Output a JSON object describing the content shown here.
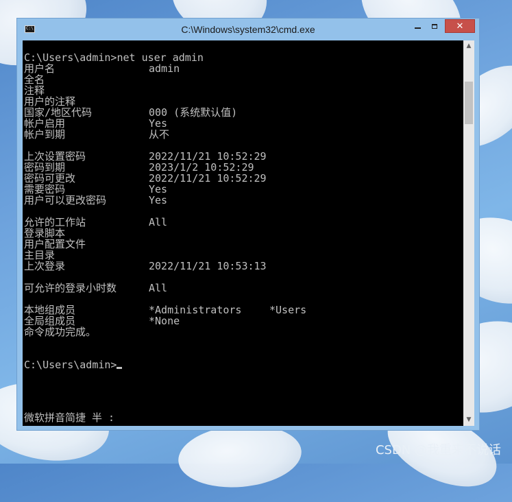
{
  "window": {
    "title": "C:\\Windows\\system32\\cmd.exe",
    "icon_text": "C:\\."
  },
  "console": {
    "lines": [
      {
        "c1": "C:\\Users\\admin>net user admin",
        "c2": "",
        "c3": ""
      },
      {
        "c1": "用户名",
        "c2": "admin",
        "c3": ""
      },
      {
        "c1": "全名",
        "c2": "",
        "c3": ""
      },
      {
        "c1": "注释",
        "c2": "",
        "c3": ""
      },
      {
        "c1": "用户的注释",
        "c2": "",
        "c3": ""
      },
      {
        "c1": "国家/地区代码",
        "c2": "000 (系统默认值)",
        "c3": ""
      },
      {
        "c1": "帐户启用",
        "c2": "Yes",
        "c3": ""
      },
      {
        "c1": "帐户到期",
        "c2": "从不",
        "c3": ""
      },
      {
        "c1": "",
        "c2": "",
        "c3": ""
      },
      {
        "c1": "上次设置密码",
        "c2": "2022/11/21 10:52:29",
        "c3": ""
      },
      {
        "c1": "密码到期",
        "c2": "2023/1/2 10:52:29",
        "c3": ""
      },
      {
        "c1": "密码可更改",
        "c2": "2022/11/21 10:52:29",
        "c3": ""
      },
      {
        "c1": "需要密码",
        "c2": "Yes",
        "c3": ""
      },
      {
        "c1": "用户可以更改密码",
        "c2": "Yes",
        "c3": ""
      },
      {
        "c1": "",
        "c2": "",
        "c3": ""
      },
      {
        "c1": "允许的工作站",
        "c2": "All",
        "c3": ""
      },
      {
        "c1": "登录脚本",
        "c2": "",
        "c3": ""
      },
      {
        "c1": "用户配置文件",
        "c2": "",
        "c3": ""
      },
      {
        "c1": "主目录",
        "c2": "",
        "c3": ""
      },
      {
        "c1": "上次登录",
        "c2": "2022/11/21 10:53:13",
        "c3": ""
      },
      {
        "c1": "",
        "c2": "",
        "c3": ""
      },
      {
        "c1": "可允许的登录小时数",
        "c2": "All",
        "c3": ""
      },
      {
        "c1": "",
        "c2": "",
        "c3": ""
      },
      {
        "c1": "本地组成员",
        "c2": "*Administrators",
        "c3": "*Users"
      },
      {
        "c1": "全局组成员",
        "c2": "*None",
        "c3": ""
      },
      {
        "c1": "命令成功完成。",
        "c2": "",
        "c3": ""
      },
      {
        "c1": "",
        "c2": "",
        "c3": ""
      },
      {
        "c1": "",
        "c2": "",
        "c3": ""
      },
      {
        "c1": "C:\\Users\\admin>",
        "c2": "",
        "c3": ""
      }
    ],
    "ime_status": "微软拼音简捷 半 :"
  },
  "watermark": "CSDN @我重来不说话"
}
